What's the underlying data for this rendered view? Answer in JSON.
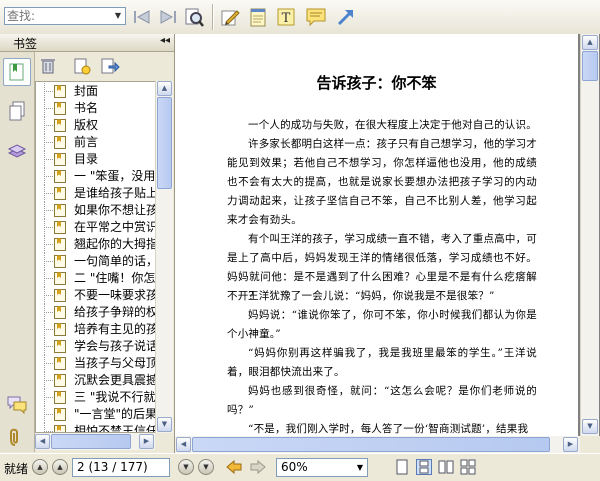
{
  "toolbar": {
    "search_placeholder": "查找:",
    "icons": [
      "prev-search-icon",
      "next-search-icon",
      "find-icon",
      "annotate-pen-icon",
      "note-pad-icon",
      "text-box-icon",
      "comment-icon",
      "arrow-icon"
    ]
  },
  "bookmark_panel": {
    "title": "书签",
    "collapse_glyph": "◂◂",
    "items": [
      "封面",
      "书名",
      "版权",
      "前言",
      "目录",
      "一 \"笨蛋，没用",
      "是谁给孩子贴上",
      "如果你不想让孩",
      "在平常之中赏识",
      "翘起你的大拇指",
      "一句简单的话，",
      "二 \"住嘴！你怎",
      "不要一味要求孩",
      "给孩子争辩的权",
      "培养有主见的孩",
      "学会与孩子说话",
      "当孩子与父母顶",
      "沉默会更具震撼",
      "三 \"我说不行就",
      "\"一言堂\"的后果",
      "相怕不禁王信任"
    ]
  },
  "document": {
    "title": "告诉孩子：你不笨",
    "paragraphs": [
      "一个人的成功与失败，在很大程度上决定于他对自己的认识。",
      "许多家长都明白这样一点：孩子只有自己想学习，他的学习才能见到效果；若他自己不想学习，你怎样逼他也没用，他的成绩也不会有太大的提高，也就是说家长要想办法把孩子学习的内动力调动起来，让孩子坚信自己不笨，自己不比别人差，他学习起来才会有劲头。",
      "有个叫王洋的孩子，学习成绩一直不错，考入了重点高中，可是上了高中后，妈妈发现王洋的情绪很低落，学习成绩也不好。妈妈就问他：是不是遇到了什么困难？心里是不是有什么疙瘩解不开？",
      "王洋犹豫了一会儿说：“妈妈，你说我是不是很笨？”",
      "妈妈说：“谁说你笨了，你可不笨，你小时候我们都认为你是个小神童。”",
      "“妈妈你别再这样骗我了，我是我班里最笨的学生。”王洋说着，眼泪都快流出来了。",
      "妈妈也感到很奇怪，就问：“这怎么会呢？是你们老师说的吗？”",
      "“不是，我们刚入学时，每人答了一份‘智商测试题’，结果我"
    ]
  },
  "status": {
    "text": "就绪",
    "page_display": "2 (13 / 177)",
    "zoom": "60%"
  }
}
